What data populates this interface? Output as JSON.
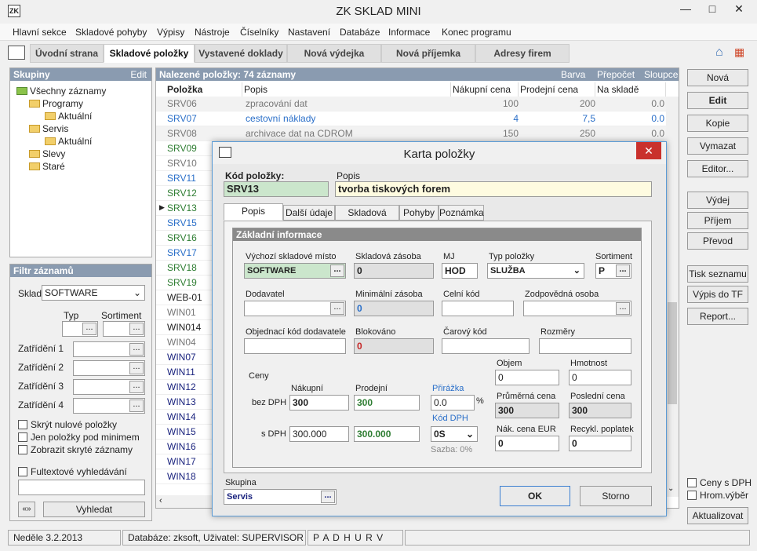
{
  "window": {
    "title": "ZK SKLAD MINI",
    "min": "—",
    "max": "□",
    "close": "✕"
  },
  "menu": [
    "Hlavní sekce",
    "Skladové pohyby",
    "Výpisy",
    "Nástroje",
    "Číselníky",
    "Nastavení",
    "Databáze",
    "Informace",
    "Konec programu"
  ],
  "tabs": [
    "Úvodní strana",
    "Skladové položky",
    "Vystavené doklady",
    "Nová výdejka",
    "Nová příjemka",
    "Adresy firem"
  ],
  "groups": {
    "title": "Skupiny",
    "edit": "Edit",
    "tree": [
      "Všechny záznamy",
      "Programy",
      "Aktuální",
      "Servis",
      "Aktuální",
      "Slevy",
      "Staré"
    ]
  },
  "filter": {
    "title": "Filtr záznamů",
    "sklad_label": "Sklad",
    "sklad_value": "SOFTWARE",
    "typ": "Typ",
    "sortiment": "Sortiment",
    "zat1": "Zatřídění 1",
    "zat2": "Zatřídění 2",
    "zat3": "Zatřídění 3",
    "zat4": "Zatřídění 4",
    "c1": "Skrýt nulové položky",
    "c2": "Jen položky pod minimem",
    "c3": "Zobrazit skryté záznamy",
    "c4": "Fultextové vyhledávání",
    "arrows": "«»",
    "search": "Vyhledat"
  },
  "grid": {
    "header": "Nalezené položky: 74 záznamy",
    "barva": "Barva",
    "prepocet": "Přepočet",
    "sloupce": "Sloupce",
    "cols": [
      "Položka",
      "Popis",
      "Nákupní cena",
      "Prodejní cena",
      "Na skladě"
    ],
    "rows": [
      {
        "code": "SRV06",
        "desc": "zpracování dat",
        "buy": "100",
        "sell": "200",
        "stock": "0.0",
        "color": "#777"
      },
      {
        "code": "SRV07",
        "desc": "cestovní náklady",
        "buy": "4",
        "sell": "7,5",
        "stock": "0.0",
        "color": "#2a6fc9"
      },
      {
        "code": "SRV08",
        "desc": "archivace dat na CDROM",
        "buy": "150",
        "sell": "250",
        "stock": "0.0",
        "color": "#777"
      },
      {
        "code": "SRV09",
        "color": "#2e7d32"
      },
      {
        "code": "SRV10",
        "color": "#777"
      },
      {
        "code": "SRV11",
        "color": "#2a6fc9"
      },
      {
        "code": "SRV12",
        "color": "#2e7d32"
      },
      {
        "code": "SRV13",
        "color": "#2e7d32"
      },
      {
        "code": "SRV15",
        "color": "#2a6fc9"
      },
      {
        "code": "SRV16",
        "color": "#2e7d32"
      },
      {
        "code": "SRV17",
        "color": "#2a6fc9"
      },
      {
        "code": "SRV18",
        "color": "#2e7d32"
      },
      {
        "code": "SRV19",
        "color": "#2e7d32"
      },
      {
        "code": "WEB-01",
        "color": "#222"
      },
      {
        "code": "WIN01",
        "color": "#777"
      },
      {
        "code": "WIN014",
        "color": "#222"
      },
      {
        "code": "WIN04",
        "color": "#777"
      },
      {
        "code": "WIN07",
        "color": "#1a237e"
      },
      {
        "code": "WIN11",
        "color": "#1a237e"
      },
      {
        "code": "WIN12",
        "color": "#1a237e"
      },
      {
        "code": "WIN13",
        "color": "#1a237e"
      },
      {
        "code": "WIN14",
        "color": "#1a237e"
      },
      {
        "code": "WIN15",
        "color": "#1a237e"
      },
      {
        "code": "WIN16",
        "color": "#1a237e"
      },
      {
        "code": "WIN17",
        "color": "#1a237e"
      },
      {
        "code": "WIN18",
        "color": "#1a237e"
      }
    ]
  },
  "right": {
    "buttons": [
      "Nová",
      "Edit",
      "Kopie",
      "Vymazat",
      "Editor...",
      "Výdej",
      "Příjem",
      "Převod",
      "Tisk seznamu",
      "Výpis do TF",
      "Report..."
    ],
    "c1": "Ceny s DPH",
    "c2": "Hrom.výběr",
    "refresh": "Aktualizovat"
  },
  "dialog": {
    "title": "Karta položky",
    "kod_label": "Kód položky:",
    "kod": "SRV13",
    "popis_label": "Popis",
    "popis": "tvorba tiskových forem",
    "tabs": [
      "Popis položky",
      "Další údaje",
      "Skladová místa",
      "Pohyby",
      "Poznámka"
    ],
    "section": "Základní informace",
    "vychozi_label": "Výchozí skladové místo",
    "vychozi": "SOFTWARE",
    "zasoba_label": "Skladová zásoba",
    "zasoba": "0",
    "mj_label": "MJ",
    "mj": "HOD",
    "typ_label": "Typ položky",
    "typ": "SLUŽBA",
    "sort_label": "Sortiment",
    "sort": "P",
    "dodavatel_label": "Dodavatel",
    "min_label": "Minimální zásoba",
    "min": "0",
    "celni_label": "Celní kód",
    "zodp_label": "Zodpovědná osoba",
    "objkod_label": "Objednací kód dodavatele",
    "blok_label": "Blokováno",
    "blok": "0",
    "carovy_label": "Čarový kód",
    "rozmery_label": "Rozměry",
    "ceny": "Ceny",
    "nakupni": "Nákupní",
    "prodejni": "Prodejní",
    "prirazka": "Přirážka",
    "bez": "bez DPH",
    "s": "s DPH",
    "n_bez": "300",
    "p_bez": "300",
    "prir": "0.0",
    "pct": "%",
    "n_s": "300.000",
    "p_s": "300.000",
    "kod_dph_label": "Kód DPH",
    "kod_dph": "0S",
    "sazba": "Sazba: 0%",
    "objem_label": "Objem",
    "objem": "0",
    "hmot_label": "Hmotnost",
    "hmot": "0",
    "prum_label": "Průměrná cena",
    "prum": "300",
    "posl_label": "Poslední cena",
    "posl": "300",
    "eur_label": "Nák. cena EUR",
    "eur": "0",
    "recykl_label": "Recykl. poplatek",
    "recykl": "0",
    "skupina_label": "Skupina",
    "skupina": "Servis",
    "ok": "OK",
    "storno": "Storno"
  },
  "status": {
    "date": "Neděle 3.2.2013",
    "db": "Databáze: zksoft, Uživatel: SUPERVISOR",
    "flags": "P A D H U R V"
  }
}
